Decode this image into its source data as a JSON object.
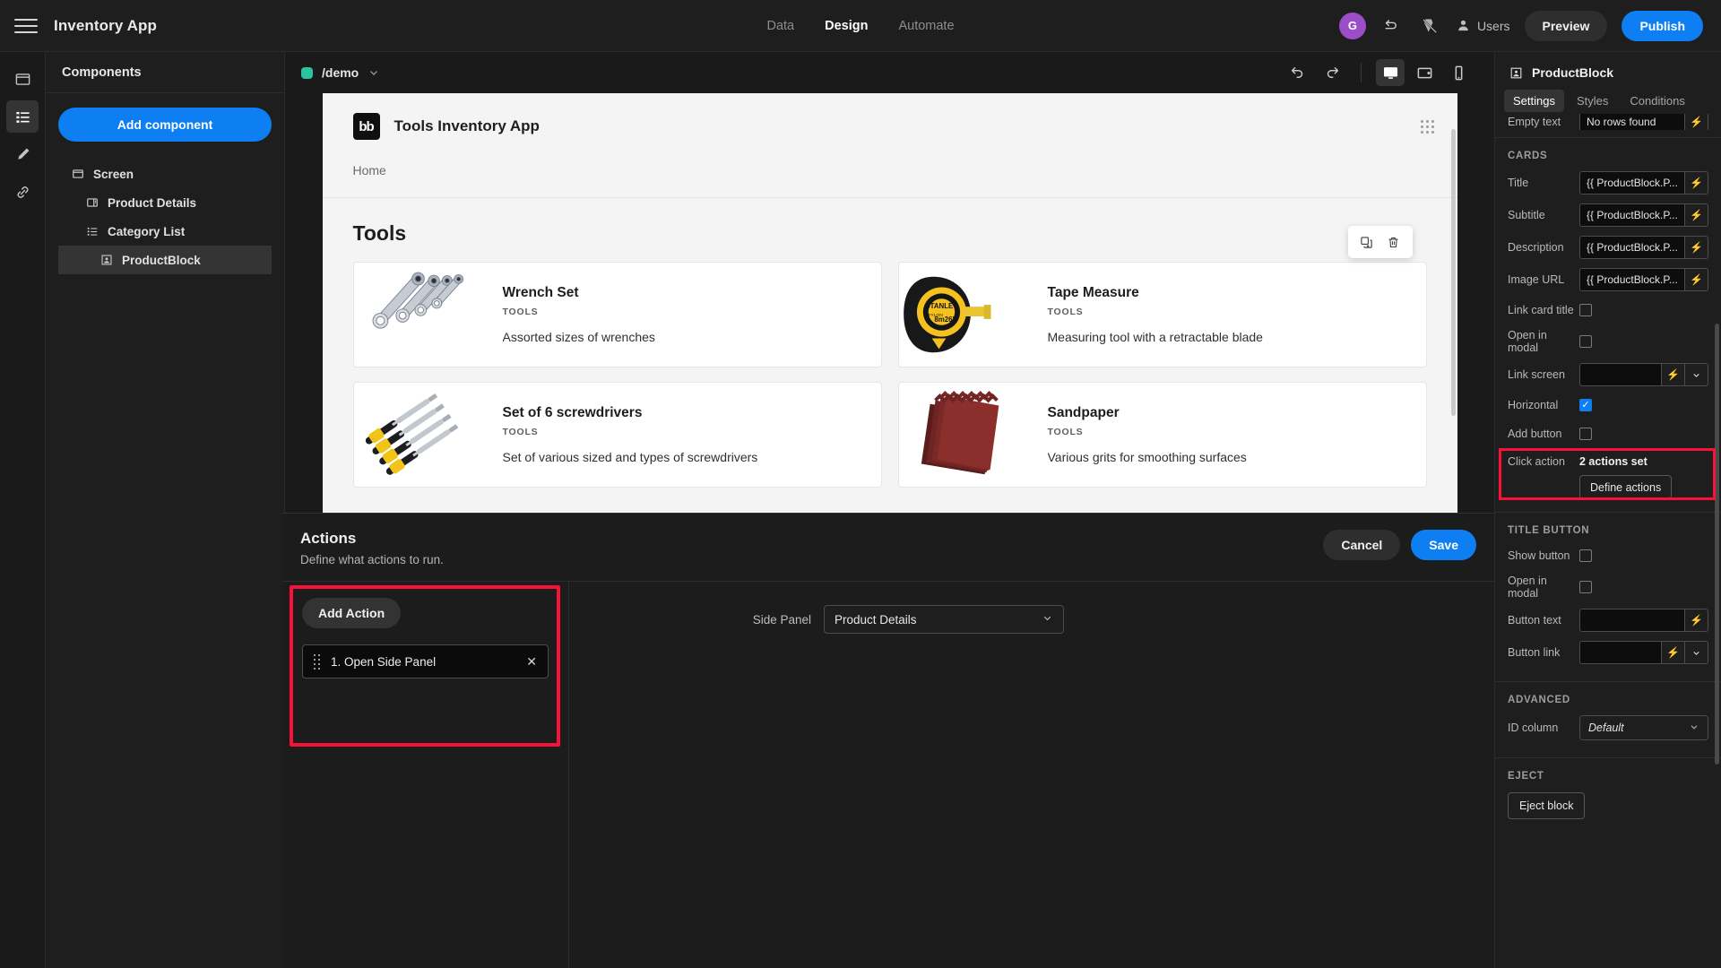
{
  "topbar": {
    "menu_icon": "hamburger-icon",
    "app_name": "Inventory App",
    "tabs": [
      {
        "label": "Data",
        "active": false
      },
      {
        "label": "Design",
        "active": true
      },
      {
        "label": "Automate",
        "active": false
      }
    ],
    "avatar_initial": "G",
    "undo_icon": "undo-icon",
    "theme_icon": "theme-icon",
    "users_label": "Users",
    "preview_label": "Preview",
    "publish_label": "Publish",
    "publish_color": "#0d7ff2"
  },
  "rail": {
    "items": [
      {
        "icon": "screen-icon",
        "active": false
      },
      {
        "icon": "components-list-icon",
        "active": true
      },
      {
        "icon": "paintbrush-icon",
        "active": false
      },
      {
        "icon": "link-icon",
        "active": false
      }
    ]
  },
  "components": {
    "header": "Components",
    "add_button": "Add component",
    "tree": [
      {
        "label": "Screen",
        "icon": "screen-icon",
        "indent": 0,
        "selected": false
      },
      {
        "label": "Product Details",
        "icon": "sidepanel-icon",
        "indent": 1,
        "selected": false
      },
      {
        "label": "Category List",
        "icon": "list-icon",
        "indent": 1,
        "selected": false
      },
      {
        "label": "ProductBlock",
        "icon": "block-icon",
        "indent": 2,
        "selected": true
      }
    ]
  },
  "canvas": {
    "screen_name": "/demo",
    "screen_dot_color": "#2bc4a0",
    "undo_icon": "undo-arrow-icon",
    "redo_icon": "redo-arrow-icon",
    "devices": [
      {
        "icon": "desktop-icon",
        "active": true
      },
      {
        "icon": "tablet-icon",
        "active": false
      },
      {
        "icon": "mobile-icon",
        "active": false
      }
    ]
  },
  "preview": {
    "logo_text": "bb",
    "title": "Tools Inventory App",
    "nav_item": "Home",
    "float_tools": [
      "duplicate-icon",
      "delete-icon"
    ],
    "section_title": "Tools",
    "cards": [
      {
        "title": "Wrench Set",
        "subtitle": "TOOLS",
        "description": "Assorted sizes of wrenches",
        "image": "wrench-set-image"
      },
      {
        "title": "Tape Measure",
        "subtitle": "TOOLS",
        "description": "Measuring tool with a retractable blade",
        "image": "tape-measure-image"
      },
      {
        "title": "Set of 6 screwdrivers",
        "subtitle": "TOOLS",
        "description": "Set of various sized and types of screwdrivers",
        "image": "screwdrivers-image"
      },
      {
        "title": "Sandpaper",
        "subtitle": "TOOLS",
        "description": "Various grits for smoothing surfaces",
        "image": "sandpaper-image"
      }
    ]
  },
  "drawer": {
    "title": "Actions",
    "subtitle": "Define what actions to run.",
    "cancel_label": "Cancel",
    "save_label": "Save",
    "add_action_label": "Add Action",
    "actions": [
      {
        "label": "1. Open Side Panel"
      }
    ],
    "side_panel_label": "Side Panel",
    "side_panel_value": "Product Details",
    "highlight_color": "#f8123a"
  },
  "settings": {
    "block_name": "ProductBlock",
    "tabs": [
      {
        "label": "Settings",
        "active": true
      },
      {
        "label": "Styles",
        "active": false
      },
      {
        "label": "Conditions",
        "active": false
      }
    ],
    "empty_text_label": "Empty text",
    "empty_text_value": "No rows found",
    "cards_group": "CARDS",
    "cards_fields": [
      {
        "label": "Title",
        "value": "{{ ProductBlock.P..."
      },
      {
        "label": "Subtitle",
        "value": "{{ ProductBlock.P..."
      },
      {
        "label": "Description",
        "value": "{{ ProductBlock.P..."
      },
      {
        "label": "Image URL",
        "value": "{{ ProductBlock.P..."
      }
    ],
    "checkboxes": [
      {
        "label": "Link card title",
        "checked": false
      },
      {
        "label": "Open in modal",
        "checked": false
      }
    ],
    "link_screen_label": "Link screen",
    "link_screen_value": "",
    "horizontal_label": "Horizontal",
    "horizontal_checked": true,
    "add_button_label": "Add button",
    "add_button_checked": false,
    "click_action_label": "Click action",
    "click_action_value": "2 actions set",
    "define_actions_label": "Define actions",
    "title_button_group": "TITLE BUTTON",
    "title_button_checkboxes": [
      {
        "label": "Show button",
        "checked": false
      },
      {
        "label": "Open in modal",
        "checked": false
      }
    ],
    "button_text_label": "Button text",
    "button_text_value": "",
    "button_link_label": "Button link",
    "button_link_value": "",
    "advanced_group": "ADVANCED",
    "id_column_label": "ID column",
    "id_column_value": "Default",
    "eject_group": "EJECT",
    "eject_label": "Eject block"
  }
}
